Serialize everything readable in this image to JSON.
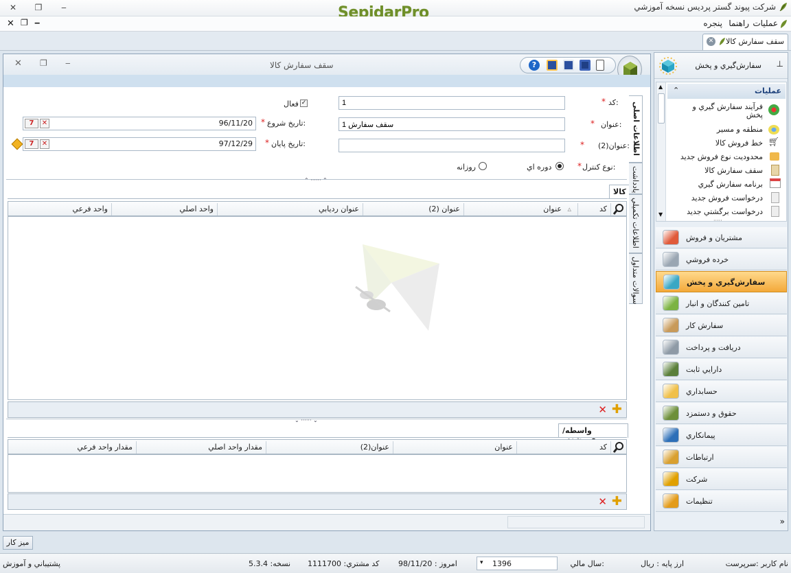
{
  "app": {
    "title": "شرکت پیوند گستر پردیس نسخه آموزشي",
    "logo": "SepidarPro"
  },
  "menu": {
    "items": [
      "عمليات",
      "راهنما",
      "پنجره"
    ]
  },
  "doc_tab": {
    "label": "سقف سفارش کالا"
  },
  "window": {
    "title": "سقف سفارش کالا"
  },
  "form": {
    "code_label": "کد:",
    "code_value": "1",
    "title_label": "عنوان:",
    "title_value": "سقف سفارش 1",
    "title2_label": "عنوان(2):",
    "title2_value": "",
    "active_label": "فعال",
    "start_label": "تاريخ  شروع:",
    "start_value": "96/11/20",
    "end_label": "تاريخ  پايان:",
    "end_value": "97/12/29",
    "control_label": "نوع کنترل:",
    "opt_period": "دوره اي",
    "opt_daily": "روزانه"
  },
  "side_tabs": [
    "اطلاعات اصلی",
    "يادداشت",
    "اطلاعات تکميلي",
    "سوالات متداول"
  ],
  "goods": {
    "tab": "کالا",
    "columns": [
      "کد",
      "عنوان",
      "عنوان (2)",
      "عنوان رديابي",
      "واحد اصلي",
      "واحد فرعي"
    ]
  },
  "agent": {
    "tab": "واسطه/ فروشنده",
    "columns": [
      "کد",
      "عنوان",
      "عنوان(2)",
      "مقدار واحد اصلي",
      "مقدار واحد فرعي"
    ]
  },
  "right_panel": {
    "header": "سفارش‌گيري و پخش",
    "ops_title": "عمليات",
    "ops": [
      "فرآيند سفارش گيري و پخش",
      "منطقه و مسير",
      "خط فروش کالا",
      "محدوديت نوع فروش جديد",
      "سقف سفارش کالا",
      "برنامه سفارش گيري",
      "درخواست فروش جديد",
      "درخواست برگشتي جديد"
    ],
    "nav": [
      "مشتريان و فروش",
      "خرده فروشي",
      "سفارش‌گيري و پخش",
      "تامين کنندگان و انبار",
      "سفارش کار",
      "دريافت و پرداخت",
      "دارايي ثابت",
      "حسابداري",
      "حقوق و دستمزد",
      "پيمانکاري",
      "ارتباطات",
      "شرکت",
      "تنظيمات"
    ],
    "nav_selected": "سفارش‌گيري و پخش"
  },
  "desk_button": "ميز کار",
  "status": {
    "user": "نام کاربر :سرپرست",
    "currency": "ارز پايه :   ريال",
    "fy_label": "سال مالي:",
    "fy_value": "1396",
    "today": "امروز :   98/11/20",
    "customer": "کد مشتري:   1111700",
    "version": "نسخه:   5.3.4",
    "support": "پشتيباني و آموزش"
  },
  "colors": {
    "accent": "#f3a93a",
    "brand": "#6f8f2a",
    "border": "#8da2b8"
  }
}
